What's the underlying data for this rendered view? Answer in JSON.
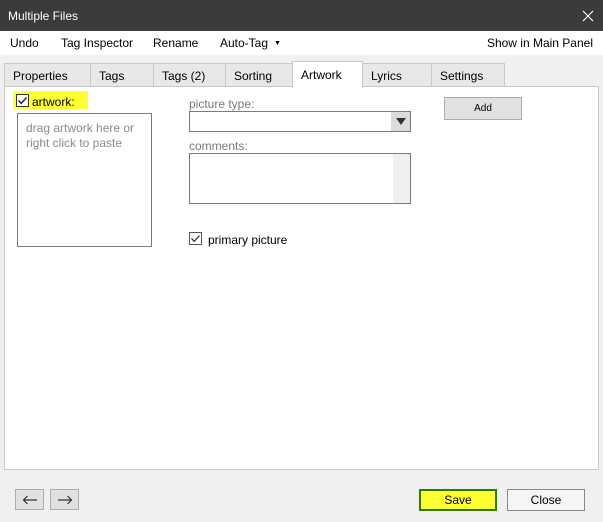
{
  "window": {
    "title": "Multiple Files",
    "close_icon": "close-icon"
  },
  "menubar": {
    "items": [
      "Undo",
      "Tag Inspector",
      "Rename",
      "Auto-Tag"
    ],
    "right": "Show in Main Panel"
  },
  "tabs": [
    "Properties",
    "Tags",
    "Tags (2)",
    "Sorting",
    "Artwork",
    "Lyrics",
    "Settings"
  ],
  "active_tab": "Artwork",
  "artwork_panel": {
    "artwork_label": "artwork:",
    "artwork_checked": true,
    "drop_hint": "drag artwork here or right click to paste",
    "picture_type_label": "picture type:",
    "picture_type_value": "",
    "comments_label": "comments:",
    "comments_value": "",
    "primary_label": "primary picture",
    "primary_checked": true,
    "add_button": "Add"
  },
  "footer": {
    "save": "Save",
    "close": "Close",
    "highlight_color": "#ffff33",
    "save_border_color": "#2f7d00"
  }
}
